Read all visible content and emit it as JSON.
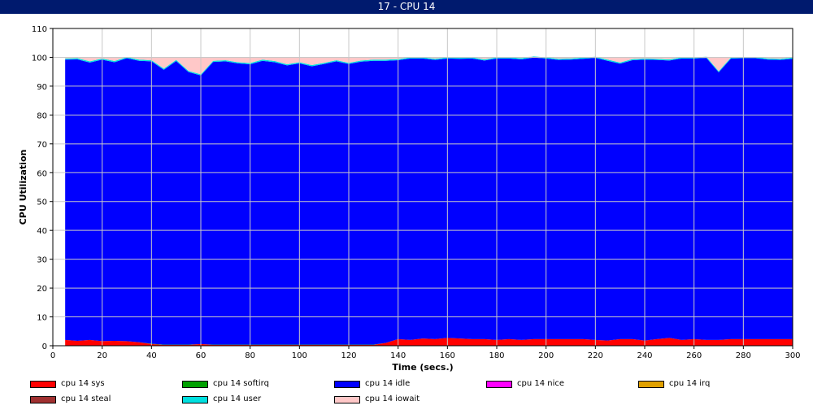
{
  "window": {
    "title": "17 - CPU 14"
  },
  "chart_data": {
    "type": "area",
    "stacked": true,
    "title": "",
    "xlabel": "Time (secs.)",
    "ylabel": "CPU Utilization",
    "xlim": [
      0,
      300
    ],
    "ylim": [
      0,
      110
    ],
    "xticks": [
      0,
      20,
      40,
      60,
      80,
      100,
      120,
      140,
      160,
      180,
      200,
      220,
      240,
      260,
      280,
      300
    ],
    "yticks": [
      0,
      10,
      20,
      30,
      40,
      50,
      60,
      70,
      80,
      90,
      100,
      110
    ],
    "grid": true,
    "legend_position": "bottom",
    "x": [
      5,
      10,
      15,
      20,
      25,
      30,
      35,
      40,
      45,
      50,
      55,
      60,
      65,
      70,
      75,
      80,
      85,
      90,
      95,
      100,
      105,
      110,
      115,
      120,
      125,
      130,
      135,
      140,
      145,
      150,
      155,
      160,
      165,
      170,
      175,
      180,
      185,
      190,
      195,
      200,
      205,
      210,
      215,
      220,
      225,
      230,
      235,
      240,
      245,
      250,
      255,
      260,
      265,
      270,
      275,
      280,
      285,
      290,
      295,
      300
    ],
    "series": [
      {
        "name": "cpu 14 sys",
        "color": "#ff0000",
        "values": [
          2.0,
          1.7,
          2.0,
          1.6,
          1.7,
          1.6,
          1.2,
          0.6,
          0.3,
          0.3,
          0.3,
          0.6,
          0.3,
          0.3,
          0.3,
          0.3,
          0.3,
          0.3,
          0.3,
          0.3,
          0.3,
          0.3,
          0.3,
          0.3,
          0.3,
          0.3,
          1.0,
          2.3,
          2.0,
          2.5,
          2.3,
          2.7,
          2.5,
          2.3,
          2.3,
          2.0,
          2.3,
          2.0,
          2.3,
          2.3,
          2.3,
          2.3,
          2.3,
          2.0,
          1.8,
          2.3,
          2.3,
          1.8,
          2.3,
          2.7,
          2.0,
          2.3,
          2.0,
          2.0,
          2.3,
          2.3,
          2.3,
          2.3,
          2.3,
          2.3
        ]
      },
      {
        "name": "cpu 14 softirq",
        "color": "#00a000",
        "values": [
          0,
          0,
          0,
          0,
          0,
          0,
          0,
          0.1,
          0.1,
          0.1,
          0.1,
          0,
          0.1,
          0.1,
          0.1,
          0.1,
          0.1,
          0.1,
          0.1,
          0.1,
          0.1,
          0.1,
          0.1,
          0.1,
          0.1,
          0.1,
          0,
          0,
          0,
          0,
          0,
          0,
          0,
          0,
          0,
          0,
          0,
          0,
          0,
          0,
          0,
          0,
          0,
          0,
          0,
          0,
          0,
          0,
          0,
          0,
          0,
          0,
          0,
          0,
          0,
          0,
          0,
          0,
          0,
          0
        ]
      },
      {
        "name": "cpu 14 idle",
        "color": "#0000ff",
        "values": [
          97.2,
          97.6,
          96.2,
          97.6,
          96.6,
          98.1,
          97.6,
          97.9,
          95.3,
          98.3,
          94.5,
          93.1,
          98.0,
          98.2,
          97.5,
          97.2,
          98.4,
          97.9,
          96.8,
          97.5,
          96.5,
          97.3,
          98.2,
          97.3,
          98.1,
          98.4,
          97.8,
          96.7,
          97.6,
          97.1,
          96.8,
          96.9,
          97.0,
          97.3,
          96.6,
          97.6,
          97.3,
          97.3,
          97.6,
          97.3,
          96.8,
          96.9,
          97.2,
          97.8,
          97.0,
          95.5,
          96.7,
          97.4,
          96.8,
          96.2,
          97.6,
          97.3,
          97.8,
          92.8,
          97.3,
          97.4,
          97.4,
          96.9,
          96.8,
          97.2
        ]
      },
      {
        "name": "cpu 14 nice",
        "color": "#ff00ff",
        "values": [
          0,
          0,
          0,
          0,
          0,
          0,
          0,
          0,
          0,
          0,
          0,
          0,
          0,
          0,
          0,
          0,
          0,
          0,
          0,
          0,
          0,
          0,
          0,
          0,
          0,
          0,
          0,
          0,
          0,
          0,
          0,
          0,
          0,
          0,
          0,
          0,
          0,
          0,
          0,
          0,
          0,
          0,
          0,
          0,
          0,
          0,
          0,
          0,
          0,
          0,
          0,
          0,
          0,
          0,
          0,
          0,
          0,
          0,
          0,
          0
        ]
      },
      {
        "name": "cpu 14 irq",
        "color": "#e0a000",
        "values": [
          0,
          0,
          0,
          0,
          0,
          0,
          0,
          0,
          0,
          0,
          0,
          0,
          0,
          0,
          0,
          0,
          0,
          0,
          0,
          0,
          0,
          0,
          0,
          0,
          0,
          0,
          0,
          0,
          0,
          0,
          0,
          0,
          0,
          0,
          0,
          0,
          0,
          0,
          0,
          0,
          0,
          0,
          0,
          0,
          0,
          0,
          0,
          0,
          0,
          0,
          0,
          0,
          0,
          0,
          0,
          0,
          0,
          0,
          0,
          0
        ]
      },
      {
        "name": "cpu 14 steal",
        "color": "#a03030",
        "values": [
          0,
          0,
          0,
          0,
          0,
          0,
          0,
          0,
          0,
          0,
          0,
          0,
          0,
          0,
          0,
          0,
          0,
          0,
          0,
          0,
          0,
          0,
          0,
          0,
          0,
          0,
          0,
          0,
          0,
          0,
          0,
          0,
          0,
          0,
          0,
          0,
          0,
          0,
          0,
          0,
          0,
          0,
          0,
          0,
          0,
          0,
          0,
          0,
          0,
          0,
          0,
          0,
          0,
          0,
          0,
          0,
          0,
          0,
          0,
          0
        ]
      },
      {
        "name": "cpu 14 user",
        "color": "#00e0e0",
        "values": [
          0.4,
          0.4,
          0.4,
          0.4,
          0.4,
          0.4,
          0.4,
          0.4,
          0.4,
          0.4,
          0.4,
          0.4,
          0.4,
          0.4,
          0.4,
          0.4,
          0.4,
          0.4,
          0.4,
          0.4,
          0.4,
          0.4,
          0.4,
          0.4,
          0.4,
          0.4,
          0.4,
          0.4,
          0.4,
          0.4,
          0.4,
          0.4,
          0.4,
          0.4,
          0.4,
          0.4,
          0.4,
          0.4,
          0.4,
          0.4,
          0.4,
          0.4,
          0.4,
          0.4,
          0.4,
          0.4,
          0.4,
          0.4,
          0.4,
          0.4,
          0.4,
          0.4,
          0.4,
          0.4,
          0.4,
          0.4,
          0.4,
          0.4,
          0.4,
          0.4
        ]
      },
      {
        "name": "cpu 14 iowait",
        "color": "#ffc8c8",
        "values": [
          0.4,
          0.3,
          1.4,
          0.4,
          1.3,
          0.0,
          0.8,
          1.0,
          3.9,
          0.9,
          4.7,
          5.9,
          1.2,
          1.0,
          1.7,
          2.0,
          0.8,
          1.3,
          2.4,
          1.7,
          2.7,
          1.9,
          1.0,
          1.9,
          1.1,
          0.8,
          0.8,
          0.6,
          0.0,
          0.0,
          0.5,
          0.0,
          0.1,
          0.0,
          0.7,
          0.0,
          0.0,
          0.3,
          0.0,
          0.0,
          0.5,
          0.4,
          0.1,
          0.0,
          0.8,
          1.8,
          0.6,
          0.4,
          0.5,
          0.7,
          0.0,
          0.0,
          0.0,
          4.8,
          0.0,
          0.0,
          0.0,
          0.4,
          0.5,
          0.1
        ]
      }
    ]
  }
}
